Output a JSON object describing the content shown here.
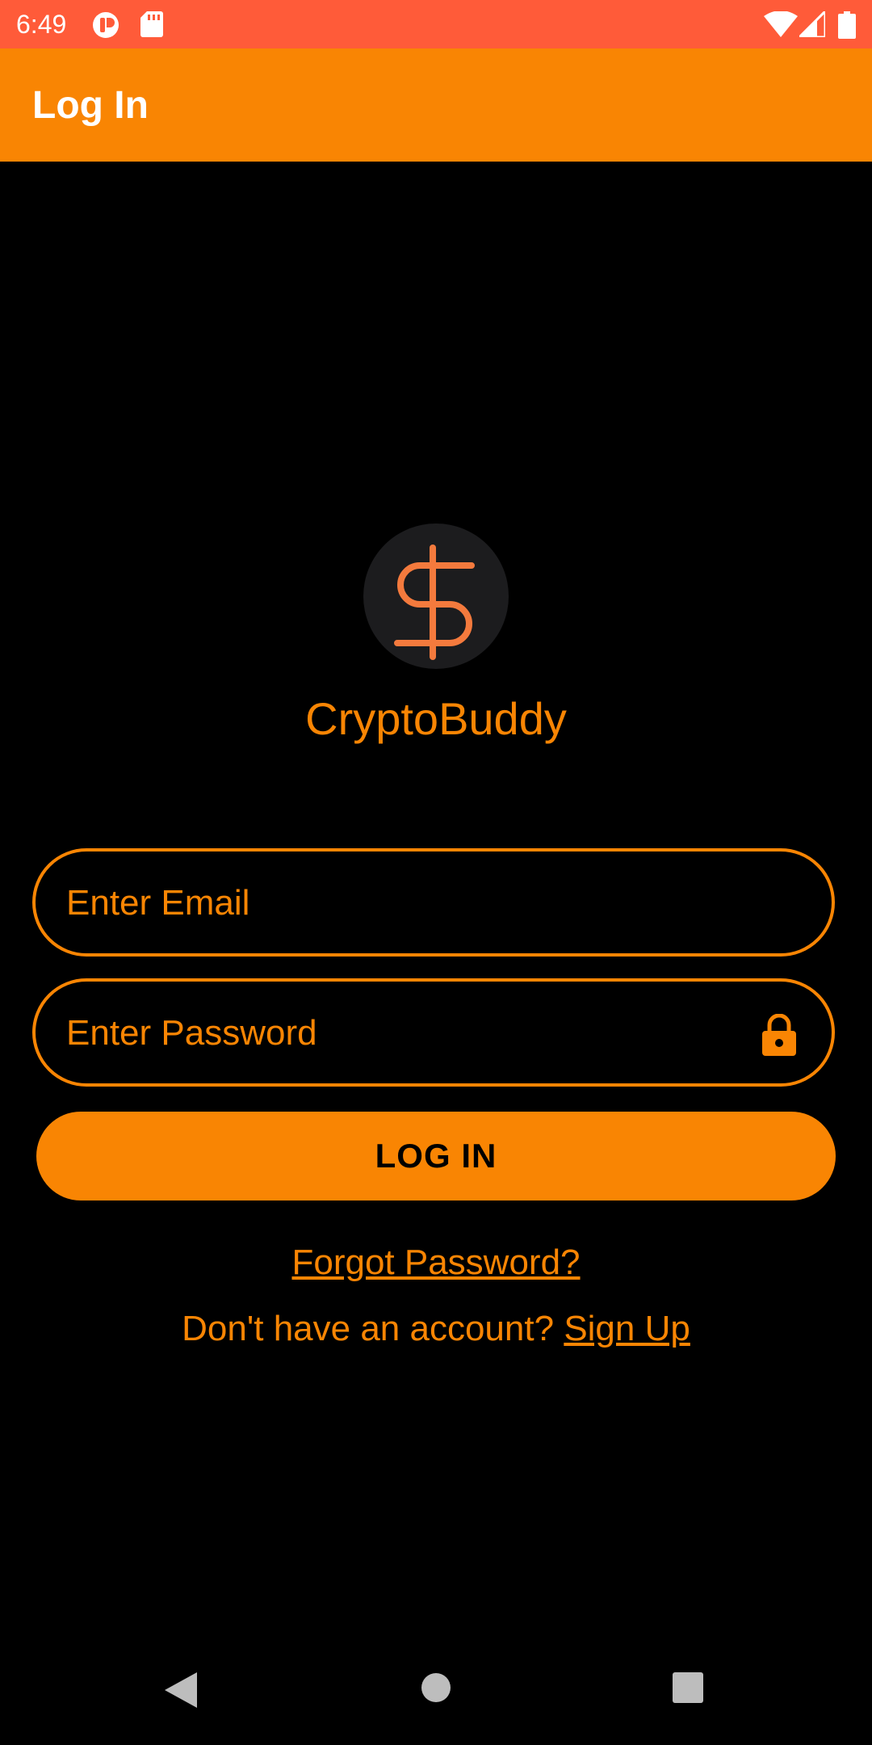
{
  "status_bar": {
    "time": "6:49",
    "background": "#FF5B39",
    "left_icons": [
      "notification-app-icon",
      "sd-card-icon"
    ],
    "right_icons": [
      "wifi-icon",
      "cell-signal-icon",
      "battery-icon"
    ]
  },
  "app_bar": {
    "title": "Log In",
    "background": "#F98503"
  },
  "logo": {
    "icon": "dollar-sign-icon",
    "app_name": "CryptoBuddy"
  },
  "form": {
    "email_placeholder": "Enter Email",
    "password_placeholder": "Enter Password",
    "password_icon": "lock-icon",
    "login_label": "LOG IN"
  },
  "links": {
    "forgot_password": "Forgot Password?",
    "signup_prompt": "Don't have an account?",
    "signup_link": "Sign Up"
  },
  "nav_bar": {
    "buttons": [
      "back-icon",
      "home-icon",
      "recents-icon"
    ]
  },
  "colors": {
    "accent": "#F98503",
    "status_bar": "#FF5B39",
    "background": "#000000"
  }
}
